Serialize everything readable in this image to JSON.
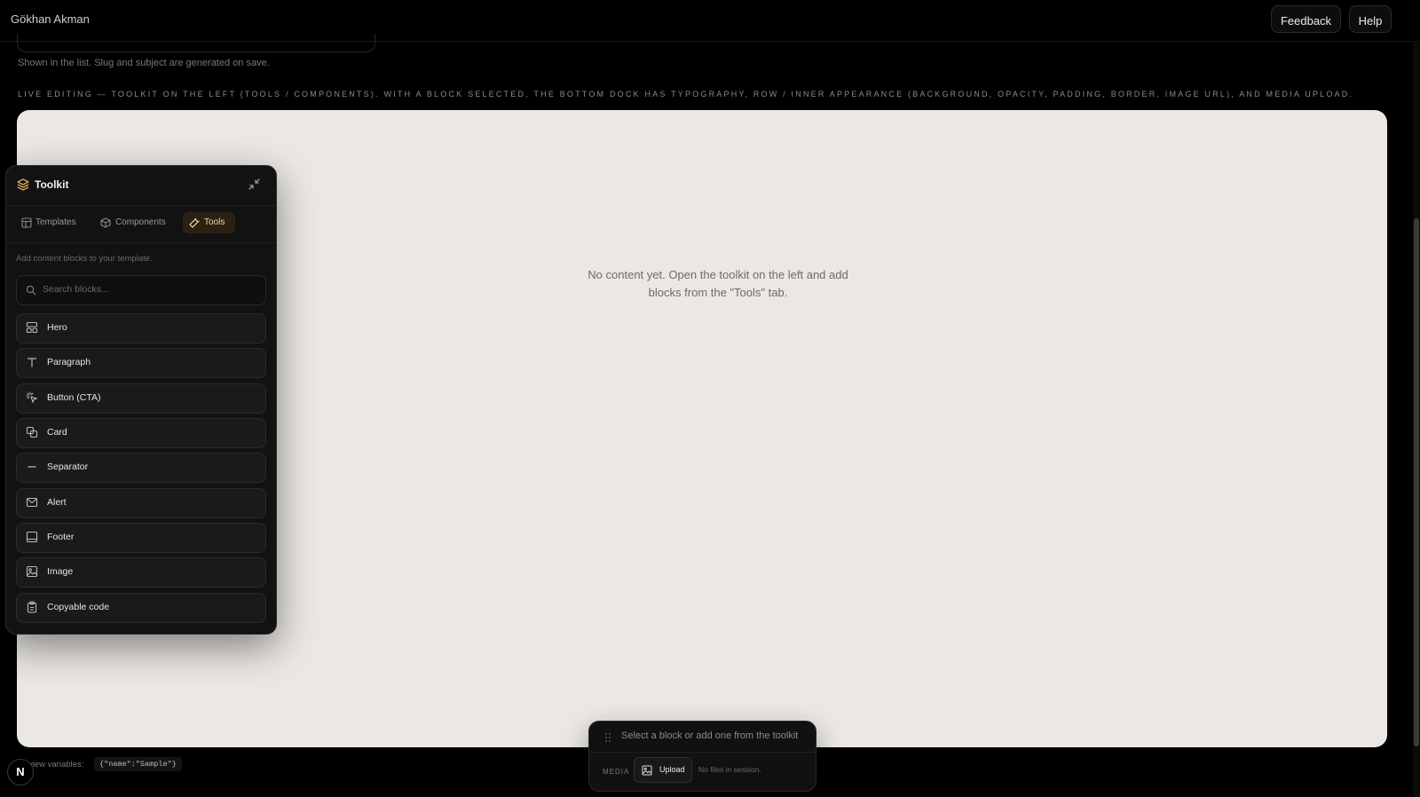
{
  "header": {
    "user_name": "Gökhan Akman",
    "feedback_label": "Feedback",
    "help_label": "Help"
  },
  "form": {
    "name_helper": "Shown in the list. Slug and subject are generated on save."
  },
  "caption": "LIVE EDITING — TOOLKIT ON THE LEFT (TOOLS / COMPONENTS). WITH A BLOCK SELECTED, THE BOTTOM DOCK HAS TYPOGRAPHY, ROW / INNER APPEARANCE (BACKGROUND, OPACITY, PADDING, BORDER, IMAGE URL), AND MEDIA UPLOAD.",
  "canvas": {
    "empty_message": "No content yet. Open the toolkit on the left and add blocks from the \"Tools\" tab."
  },
  "toolkit": {
    "title": "Toolkit",
    "tabs": [
      {
        "label": "Templates",
        "icon": "layout-icon",
        "active": false
      },
      {
        "label": "Components",
        "icon": "box-icon",
        "active": false
      },
      {
        "label": "Tools",
        "icon": "wrench-icon",
        "active": true
      }
    ],
    "hint": "Add content blocks to your template.",
    "search_placeholder": "Search blocks...",
    "items": [
      {
        "label": "Hero",
        "icon": "layout-icon"
      },
      {
        "label": "Paragraph",
        "icon": "type-icon"
      },
      {
        "label": "Button (CTA)",
        "icon": "pointer-click-icon"
      },
      {
        "label": "Card",
        "icon": "shapes-icon"
      },
      {
        "label": "Separator",
        "icon": "minus-icon"
      },
      {
        "label": "Alert",
        "icon": "mail-icon"
      },
      {
        "label": "Footer",
        "icon": "panel-bottom-icon"
      },
      {
        "label": "Image",
        "icon": "image-icon"
      },
      {
        "label": "Copyable code",
        "icon": "clipboard-icon"
      }
    ]
  },
  "dock": {
    "message": "Select a block or add one from the toolkit",
    "media_label": "MEDIA",
    "upload_label": "Upload",
    "no_files": "No files in session."
  },
  "preview": {
    "label": "view variables:",
    "code": "{\"name\":\"Sample\"}"
  },
  "badge": "N",
  "colors": {
    "background": "#000000",
    "canvas": "#ebe8e3",
    "accent": "#f1d9a8",
    "active_tab_bg": "#2b2113"
  }
}
